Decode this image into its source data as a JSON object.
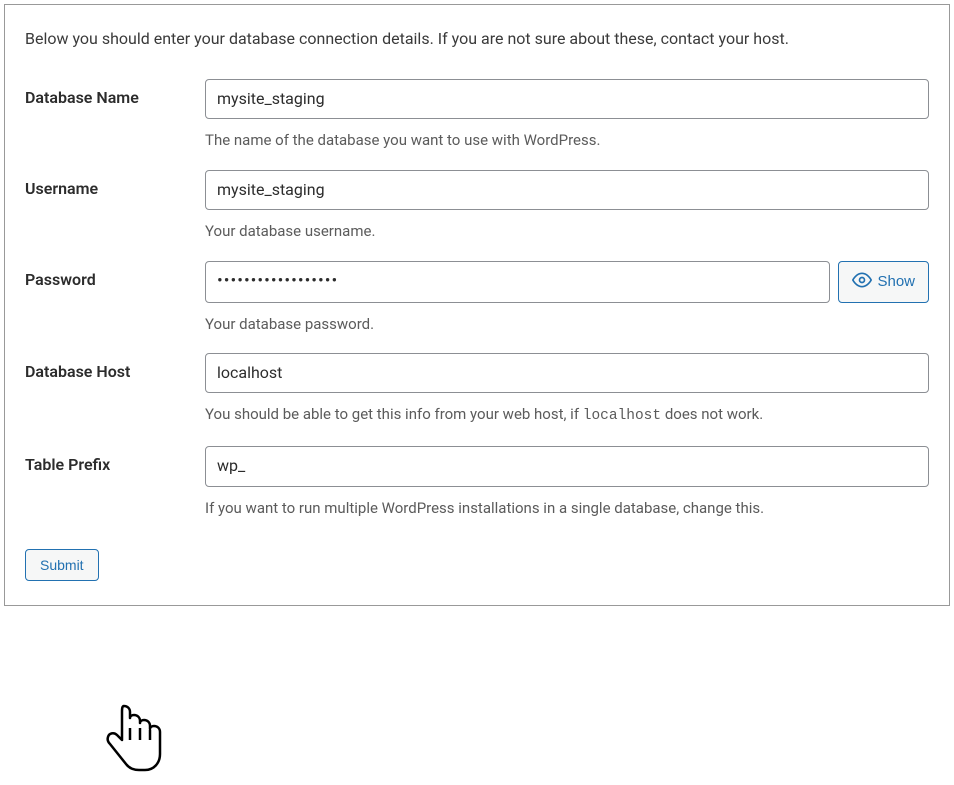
{
  "intro": "Below you should enter your database connection details. If you are not sure about these, contact your host.",
  "fields": {
    "dbname": {
      "label": "Database Name",
      "value": "mysite_staging",
      "help": "The name of the database you want to use with WordPress."
    },
    "username": {
      "label": "Username",
      "value": "mysite_staging",
      "help": "Your database username."
    },
    "password": {
      "label": "Password",
      "value": "••••••••••••••••••",
      "help": "Your database password.",
      "show_label": "Show"
    },
    "dbhost": {
      "label": "Database Host",
      "value": "localhost",
      "help_pre": "You should be able to get this info from your web host, if ",
      "help_code": "localhost",
      "help_post": " does not work."
    },
    "prefix": {
      "label": "Table Prefix",
      "value": "wp_",
      "help": "If you want to run multiple WordPress installations in a single database, change this."
    }
  },
  "submit_label": "Submit"
}
